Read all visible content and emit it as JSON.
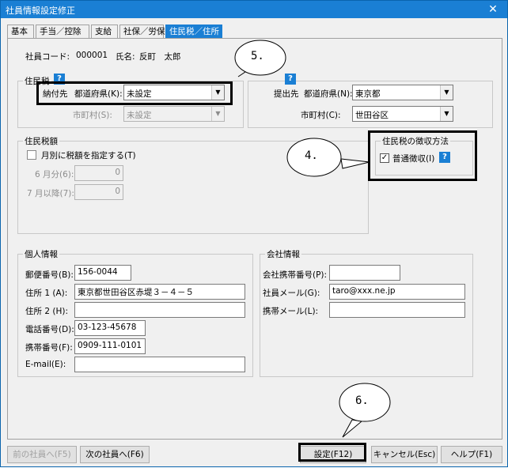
{
  "window": {
    "title": "社員情報設定修正",
    "close_glyph": "✕"
  },
  "tabs": [
    {
      "label": "基本"
    },
    {
      "label": "手当／控除"
    },
    {
      "label": "支給"
    },
    {
      "label": "社保／労保"
    },
    {
      "label": "住民税／住所"
    }
  ],
  "employee": {
    "code_label": "社員コード:",
    "code_value": "000001",
    "name_label": "氏名:",
    "name_value": "反町　太郎"
  },
  "resident_tax": {
    "group_title": "住民税",
    "help": "?",
    "payee_label": "納付先",
    "pref_label": "都道府県(K):",
    "pref_value": "未設定",
    "city_label": "市町村(S):",
    "city_value": "未設定"
  },
  "submit": {
    "help": "?",
    "dest_label": "提出先",
    "pref_label": "都道府県(N):",
    "pref_value": "東京都",
    "city_label": "市町村(C):",
    "city_value": "世田谷区"
  },
  "tax_amount": {
    "group_title": "住民税額",
    "monthly_label": "月別に税額を指定する(T)",
    "june_label": "6 月分(6):",
    "june_value": "0",
    "july_label": "7 月以降(7):",
    "july_value": "0"
  },
  "collection": {
    "group_title": "住民税の徴収方法",
    "ordinary_label": "普通徴収(I)",
    "ordinary_checked": "✓",
    "help": "?"
  },
  "personal": {
    "group_title": "個人情報",
    "postal_label": "郵便番号(B):",
    "postal_value": "156-0044",
    "addr1_label": "住所 1 (A):",
    "addr1_value": "東京都世田谷区赤堤３－４－５",
    "addr2_label": "住所 2 (H):",
    "addr2_value": "",
    "phone_label": "電話番号(D):",
    "phone_value": "03-123-45678",
    "mobile_label": "携帯番号(F):",
    "mobile_value": "0909-111-0101",
    "email_label": "E-mail(E):",
    "email_value": ""
  },
  "company": {
    "group_title": "会社情報",
    "mobile_label": "会社携帯番号(P):",
    "mobile_value": "",
    "email_label": "社員メール(G):",
    "email_value": "taro@xxx.ne.jp",
    "mobile_email_label": "携帯メール(L):",
    "mobile_email_value": ""
  },
  "buttons": {
    "prev": "前の社員へ(F5)",
    "next": "次の社員へ(F6)",
    "save": "設定(F12)",
    "cancel": "キャンセル(Esc)",
    "help": "ヘルプ(F1)"
  },
  "callouts": {
    "c5": "5.",
    "c4": "4.",
    "c6": "6."
  }
}
